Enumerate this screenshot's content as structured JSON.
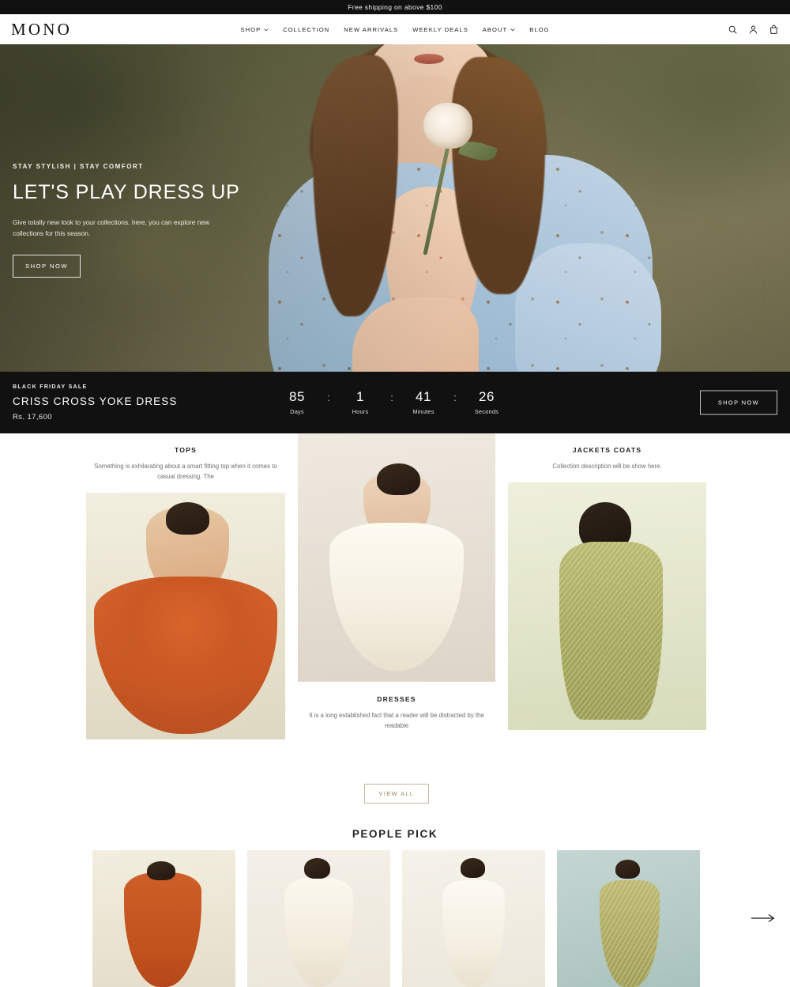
{
  "announcement": {
    "text": "Free shipping on above $100"
  },
  "header": {
    "logo": "MONO",
    "nav": [
      {
        "label": "SHOP",
        "has_caret": true
      },
      {
        "label": "COLLECTION",
        "has_caret": false
      },
      {
        "label": "NEW ARRIVALS",
        "has_caret": false
      },
      {
        "label": "WEEKLY DEALS",
        "has_caret": false
      },
      {
        "label": "ABOUT",
        "has_caret": true
      },
      {
        "label": "BLOG",
        "has_caret": false
      }
    ],
    "icons": [
      {
        "name": "search-icon"
      },
      {
        "name": "account-icon"
      },
      {
        "name": "cart-icon"
      }
    ]
  },
  "hero": {
    "eyebrow": "STAY STYLISH | STAY COMFORT",
    "title": "LET'S PLAY DRESS UP",
    "subtitle": "Give totally new look to your collections. here, you can explore new collections for this season.",
    "cta": "SHOP NOW"
  },
  "promo": {
    "eyebrow": "BLACK FRIDAY SALE",
    "title": "CRISS CROSS YOKE DRESS",
    "price": "Rs. 17,600",
    "cta": "SHOP NOW",
    "separator": ":",
    "countdown": [
      {
        "value": "85",
        "label": "Days"
      },
      {
        "value": "1",
        "label": "Hours"
      },
      {
        "value": "41",
        "label": "Minutes"
      },
      {
        "value": "26",
        "label": "Seconds"
      }
    ]
  },
  "collections": {
    "items": [
      {
        "title": "TOPS",
        "description": "Something is exhilarating about a smart fitting top when it comes to casual dressing. The"
      },
      {
        "title": "DRESSES",
        "description": "It is a long established fact that a reader will be distracted by the readable"
      },
      {
        "title": "JACKETS COATS",
        "description": "Collection description will be show here."
      }
    ],
    "view_all": "VIEW ALL"
  },
  "people_pick": {
    "heading": "PEOPLE PICK",
    "next_icon": "arrow-right-icon",
    "products": [
      {
        "alt": "orange halter top and flared skirt"
      },
      {
        "alt": "cream sheer blouse and long skirt"
      },
      {
        "alt": "ivory halter top and column skirt"
      },
      {
        "alt": "olive halter top and metallic skirt"
      }
    ]
  },
  "colors": {
    "ink": "#111111",
    "accent_tan": "#9c8561",
    "accent_border": "#c8b79b",
    "muted_text": "#6f6f6f"
  }
}
